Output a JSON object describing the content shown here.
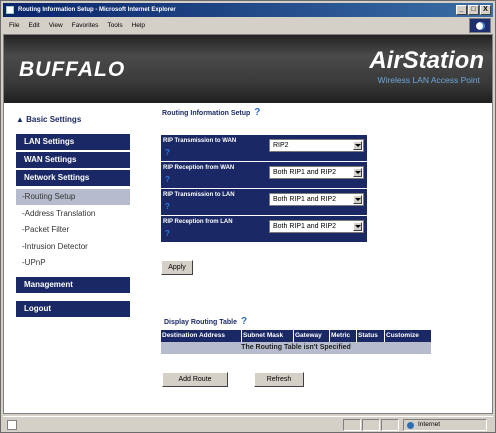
{
  "window": {
    "title": "Routing Information Setup - Microsoft Internet Explorer",
    "controls": [
      "_",
      "□",
      "X"
    ]
  },
  "menu": [
    "File",
    "Edit",
    "View",
    "Favorites",
    "Tools",
    "Help"
  ],
  "banner": {
    "brand": "BUFFALO",
    "product": "AirStation",
    "tagline": "Wireless LAN Access Point"
  },
  "sidebar": {
    "basic": "▲ Basic Settings",
    "lan": "LAN Settings",
    "wan": "WAN Settings",
    "network": "Network Settings",
    "sub": [
      "-Routing Setup",
      "-Address Translation",
      "-Packet Filter",
      "-Intrusion Detector",
      "-UPnP"
    ],
    "management": "Management",
    "logout": "Logout"
  },
  "routing": {
    "title": "Routing Information Setup",
    "rows": [
      {
        "label": "RIP Transmission to WAN",
        "value": "RIP2"
      },
      {
        "label": "RIP Reception from WAN",
        "value": "Both RIP1 and RIP2"
      },
      {
        "label": "RIP Transmission to LAN",
        "value": "Both RIP1 and RIP2"
      },
      {
        "label": "RIP Reception from LAN",
        "value": "Both RIP1 and RIP2"
      }
    ],
    "apply": "Apply"
  },
  "table": {
    "title": "Display Routing Table",
    "headers": [
      "Destination Address",
      "Subnet Mask",
      "Gateway",
      "Metric",
      "Status",
      "Customize"
    ],
    "empty": "The Routing Table isn't Specified",
    "add_route": "Add Route",
    "refresh": "Refresh"
  },
  "status": {
    "zone": "Internet"
  }
}
